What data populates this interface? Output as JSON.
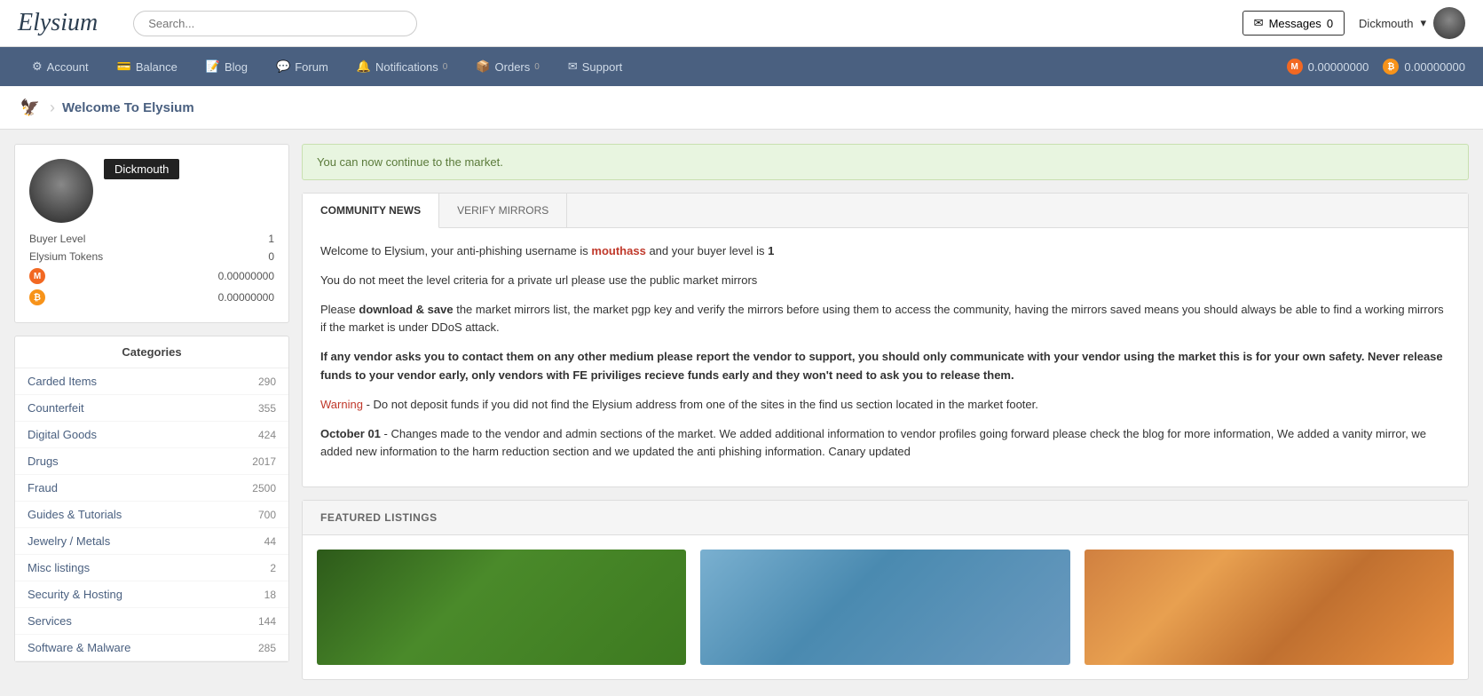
{
  "header": {
    "logo": "Elysium",
    "search_placeholder": "Search...",
    "messages_label": "Messages",
    "messages_icon": "✉",
    "messages_count": "0",
    "username": "Dickmouth",
    "monero_balance": "0.00000000",
    "bitcoin_balance": "0.00000000"
  },
  "nav": {
    "items": [
      {
        "label": "Account",
        "icon": "⚙",
        "badge": ""
      },
      {
        "label": "Balance",
        "icon": "💳",
        "badge": ""
      },
      {
        "label": "Blog",
        "icon": "📝",
        "badge": ""
      },
      {
        "label": "Forum",
        "icon": "💬",
        "badge": ""
      },
      {
        "label": "Notifications",
        "icon": "🔔",
        "badge": "0"
      },
      {
        "label": "Orders",
        "icon": "📦",
        "badge": "0"
      },
      {
        "label": "Support",
        "icon": "✉",
        "badge": ""
      }
    ],
    "monero_balance": "0.00000000",
    "bitcoin_balance": "0.00000000"
  },
  "breadcrumb": {
    "title": "Welcome To Elysium"
  },
  "user_card": {
    "username": "Dickmouth",
    "buyer_level_label": "Buyer Level",
    "buyer_level_value": "1",
    "tokens_label": "Elysium Tokens",
    "tokens_value": "0",
    "monero_balance": "0.00000000",
    "bitcoin_balance": "0.00000000"
  },
  "categories": {
    "header": "Categories",
    "items": [
      {
        "label": "Carded Items",
        "count": "290"
      },
      {
        "label": "Counterfeit",
        "count": "355"
      },
      {
        "label": "Digital Goods",
        "count": "424"
      },
      {
        "label": "Drugs",
        "count": "2017"
      },
      {
        "label": "Fraud",
        "count": "2500"
      },
      {
        "label": "Guides & Tutorials",
        "count": "700"
      },
      {
        "label": "Jewelry / Metals",
        "count": "44"
      },
      {
        "label": "Misc listings",
        "count": "2"
      },
      {
        "label": "Security & Hosting",
        "count": "18"
      },
      {
        "label": "Services",
        "count": "144"
      },
      {
        "label": "Software & Malware",
        "count": "285"
      }
    ]
  },
  "alert": {
    "text": "You can now continue to the market."
  },
  "news": {
    "tab_community": "COMMUNITY NEWS",
    "tab_mirrors": "VERIFY MIRRORS",
    "username": "mouthass",
    "buyer_level": "1",
    "intro": "Welcome to Elysium, your anti-phishing username is",
    "intro2": "and your buyer level is",
    "criteria_text": "You do not meet the level criteria for a private url please use the public market mirrors",
    "download_pre": "Please",
    "download_bold": "download & save",
    "download_post": "the market mirrors list, the market pgp key and verify the mirrors before using them to access the community, having the mirrors saved means you should always be able to find a working mirrors if the market is under DDoS attack.",
    "vendor_warning_bold": "If any vendor asks you to contact them on any other medium please report the vendor to support, you should only communicate with your vendor using the market this is for your own safety. Never release funds to your vendor early, only vendors with FE priviliges recieve funds early and they won't need to ask you to release them.",
    "warning_label": "Warning",
    "warning_text": "- Do not deposit funds if you did not find the Elysium address from one of the sites in the find us section located in the market footer.",
    "october_label": "October 01",
    "october_text": "- Changes made to the vendor and admin sections of the market. We added additional information to vendor profiles going forward please check the blog for more information, We added a vanity mirror, we added new information to the harm reduction section and we updated the anti phishing information. Canary updated"
  },
  "featured": {
    "header": "FEATURED LISTINGS"
  }
}
